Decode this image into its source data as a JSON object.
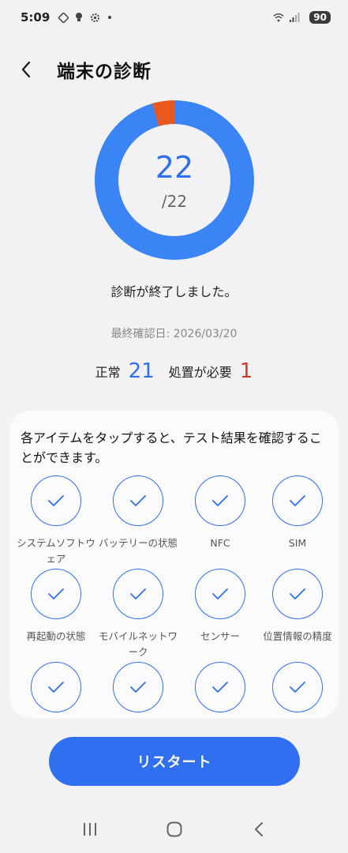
{
  "status_bar": {
    "time": "5:09",
    "battery": "90"
  },
  "header": {
    "title": "端末の診断"
  },
  "score": {
    "passed": "22",
    "total": "/22"
  },
  "donut": {
    "ok_fraction": 0.955,
    "ng_fraction": 0.045,
    "ok_color": "#3a84f5",
    "ng_color": "#e8591f"
  },
  "status": {
    "completed": "診断が終了しました。",
    "last_checked": "最終確認日: 2026/03/20"
  },
  "summary": {
    "normal_label": "正常",
    "normal_count": "21",
    "action_label": "処置が必要",
    "action_count": "1"
  },
  "card": {
    "description": "各アイテムをタップすると、テスト結果を確認することができます。",
    "items": [
      {
        "label": "システムソフトウェア"
      },
      {
        "label": "バッテリーの状態"
      },
      {
        "label": "NFC"
      },
      {
        "label": "SIM"
      },
      {
        "label": "再起動の状態"
      },
      {
        "label": "モバイルネットワーク"
      },
      {
        "label": "センサー"
      },
      {
        "label": "位置情報の精度"
      },
      {
        "label": ""
      },
      {
        "label": ""
      },
      {
        "label": ""
      },
      {
        "label": ""
      }
    ]
  },
  "restart_button": {
    "label": "リスタート"
  },
  "colors": {
    "accent": "#2f6ff0",
    "warning": "#d03a2d"
  },
  "navbar": {
    "icons": [
      "recent-apps-icon",
      "home-icon",
      "back-icon"
    ]
  }
}
